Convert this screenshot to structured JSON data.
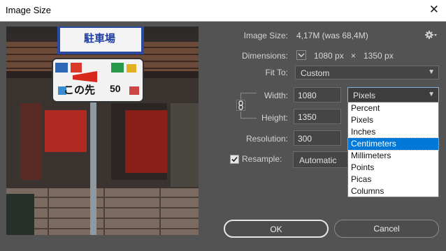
{
  "window": {
    "title": "Image Size",
    "close_glyph": "✕"
  },
  "image_size": {
    "label": "Image Size:",
    "value": "4,17M (was 68,4M)"
  },
  "dimensions": {
    "label": "Dimensions:",
    "width": "1080 px",
    "times": "×",
    "height": "1350 px"
  },
  "fit_to": {
    "label": "Fit To:",
    "value": "Custom"
  },
  "width": {
    "label": "Width:",
    "value": "1080",
    "unit": "Pixels"
  },
  "height": {
    "label": "Height:",
    "value": "1350"
  },
  "resolution": {
    "label": "Resolution:",
    "value": "300"
  },
  "resample": {
    "label": "Resample:",
    "checked": true,
    "value": "Automatic"
  },
  "unit_dropdown": {
    "options": [
      "Percent",
      "Pixels",
      "Inches",
      "Centimeters",
      "Millimeters",
      "Points",
      "Picas",
      "Columns"
    ],
    "highlighted": "Centimeters"
  },
  "preview_sign": {
    "kanji_top": "駐車場",
    "text_mid": "この先",
    "number": "50"
  },
  "buttons": {
    "ok": "OK",
    "cancel": "Cancel"
  },
  "colors": {
    "background": "#535353",
    "highlight": "#0078d7"
  }
}
